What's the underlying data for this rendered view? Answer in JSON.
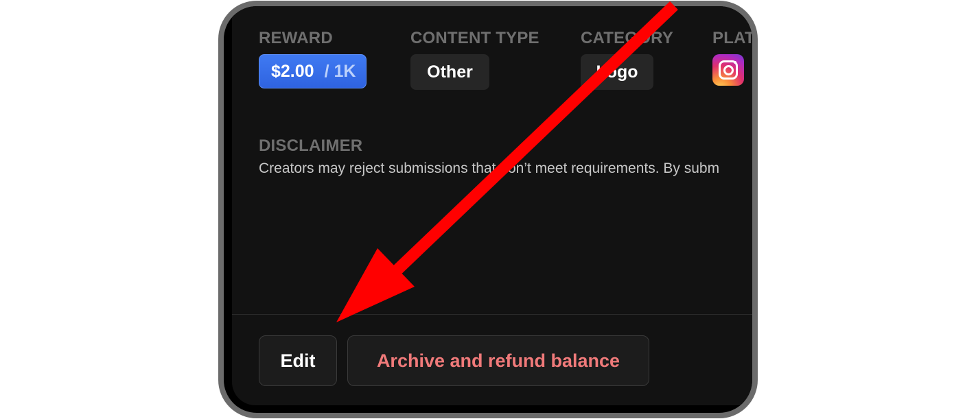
{
  "labels": {
    "reward": "REWARD",
    "content_type": "CONTENT TYPE",
    "category": "CATEGORY",
    "platform": "PLATF",
    "disclaimer": "DISCLAIMER"
  },
  "reward": {
    "amount": "$2.00",
    "unit": "/ 1K"
  },
  "content_type": {
    "value": "Other"
  },
  "category": {
    "value": "Logo"
  },
  "platform": {
    "icon": "instagram-icon"
  },
  "disclaimer_text": "Creators may reject submissions that don’t meet requirements. By subm",
  "buttons": {
    "edit": "Edit",
    "archive": "Archive and refund balance"
  },
  "colors": {
    "annotation_arrow": "#ff0000",
    "reward_pill": "#3a72ef",
    "archive_text": "#f07a7a",
    "panel_bg": "#121212"
  }
}
